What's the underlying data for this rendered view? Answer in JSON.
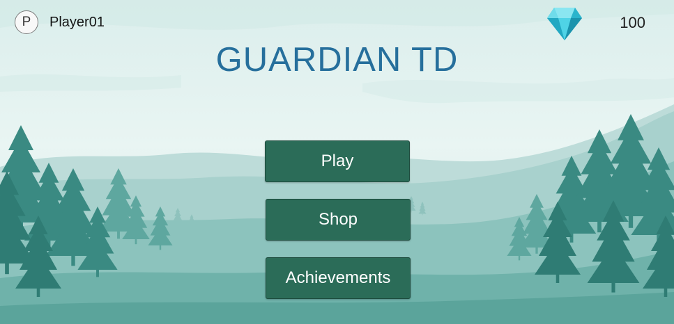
{
  "player": {
    "avatar_letter": "P",
    "name": "Player01"
  },
  "currency": {
    "icon": "diamond-gem-icon",
    "amount": "100"
  },
  "title": "GUARDIAN TD",
  "menu": {
    "play_label": "Play",
    "shop_label": "Shop",
    "achievements_label": "Achievements"
  },
  "colors": {
    "button_bg": "#2b6c58",
    "title": "#266f9c",
    "sky": "#e4f3f1",
    "gem": "#35c6dc"
  }
}
